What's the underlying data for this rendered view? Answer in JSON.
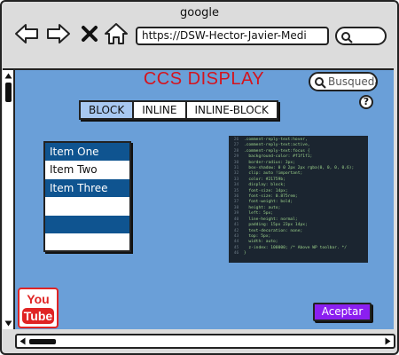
{
  "browser": {
    "title": "google",
    "url": "https://DSW-Hector-Javier-Medi",
    "icons": [
      "back-arrow-icon",
      "forward-arrow-icon",
      "close-icon",
      "home-icon",
      "search-icon"
    ]
  },
  "page": {
    "heading": "CCS DISPLAY",
    "search_placeholder": "Busqueda",
    "help_label": "?",
    "tabs": [
      {
        "label": "BLOCK",
        "active": true
      },
      {
        "label": "INLINE",
        "active": false
      },
      {
        "label": "INLINE-BLOCK",
        "active": false
      }
    ],
    "list_items": [
      {
        "label": "Item One",
        "style": "dark"
      },
      {
        "label": "Item Two",
        "style": "light"
      },
      {
        "label": "Item Three",
        "style": "dark"
      },
      {
        "label": "",
        "style": "light"
      },
      {
        "label": "",
        "style": "dark"
      },
      {
        "label": "",
        "style": "light"
      }
    ],
    "code_lines": [
      ".comment-reply-text:hover,",
      ".comment-reply-text:active,",
      ".comment-reply-text:focus {",
      "  background-color: #f1f1f1;",
      "  border-radius: 3px;",
      "  box-shadow: 0 0 2px 2px rgba(0, 0, 0, 0.6);",
      "  clip: auto !important;",
      "  color: #21759b;",
      "  display: block;",
      "  font-size: 14px;",
      "  font-size: 0.875rem;",
      "  font-weight: bold;",
      "  height: auto;",
      "  left: 5px;",
      "  line-height: normal;",
      "  padding: 15px 23px 14px;",
      "  text-decoration: none;",
      "  top: 5px;",
      "  width: auto;",
      "  z-index: 100000; /* Above WP toolbar. */",
      "}"
    ],
    "youtube_logo": "YouTube",
    "accept_label": "Aceptar"
  },
  "colors": {
    "content_bg": "#6a9fd8",
    "heading": "#d4141e",
    "list_dark": "#0f5490",
    "accept_bg": "#8b1ff0",
    "tab_active": "#a8c8f0",
    "youtube_red": "#e02424"
  }
}
